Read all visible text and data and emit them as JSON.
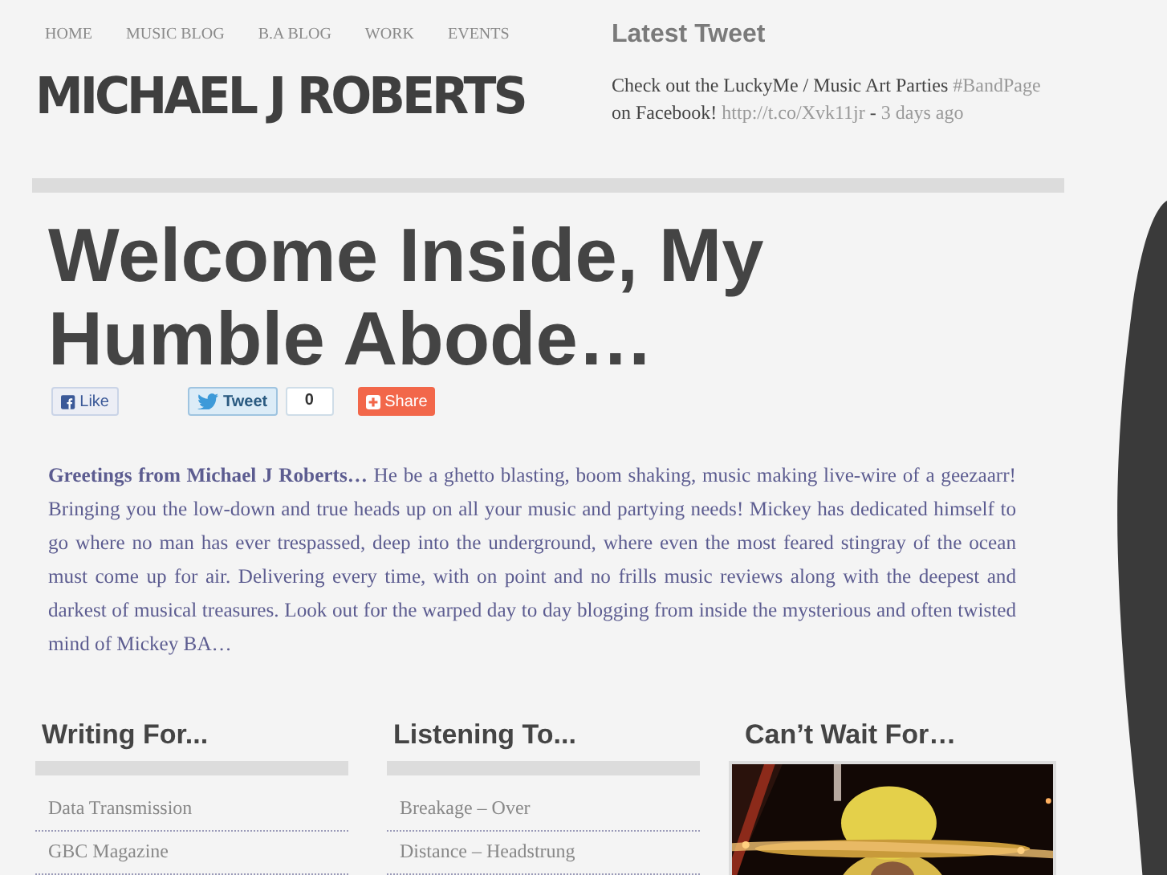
{
  "nav": [
    {
      "label": "HOME"
    },
    {
      "label": "MUSIC BLOG"
    },
    {
      "label": "B.A BLOG"
    },
    {
      "label": "WORK"
    },
    {
      "label": "EVENTS"
    }
  ],
  "logo": "MICHAEL J ROBERTS",
  "tweet": {
    "title": "Latest Tweet",
    "parts": [
      {
        "kind": "text",
        "text": "Check out the LuckyMe / Music Art Parties "
      },
      {
        "kind": "link",
        "text": "#BandPage"
      },
      {
        "kind": "text",
        "text": " on Facebook! "
      },
      {
        "kind": "link",
        "text": "http://t.co/Xvk11jr"
      },
      {
        "kind": "text",
        "text": " - "
      },
      {
        "kind": "link",
        "text": "3 days ago"
      }
    ]
  },
  "heading": "Welcome Inside, My Humble Abode…",
  "social": {
    "like": "Like",
    "tweet": "Tweet",
    "tweet_count": "0",
    "share": "Share"
  },
  "intro": "**Greetings  from Michael J Roberts…** He be a ghetto blasting, boom shaking, music making live-wire of a geezaarr! Bringing you the low-down and true heads up on all your music and partying needs! Mickey has dedicated himself to go where no man has ever trespassed, deep into the underground, where even the most feared stingray of the ocean  must come up for air. Delivering every time, with on point and no frills music reviews along with the deepest and darkest of musical treasures. Look out for the warped day to day blogging from inside the mysterious and often twisted mind of Mickey BA…",
  "columns": [
    {
      "kind": "list",
      "title": "Writing For...",
      "items": [
        "Data Transmission",
        "GBC Magazine"
      ]
    },
    {
      "kind": "list",
      "title": "Listening To...",
      "items": [
        "Breakage – Over",
        "Distance – Headstrung"
      ]
    },
    {
      "kind": "picture",
      "title": "Can’t Wait For…"
    }
  ]
}
